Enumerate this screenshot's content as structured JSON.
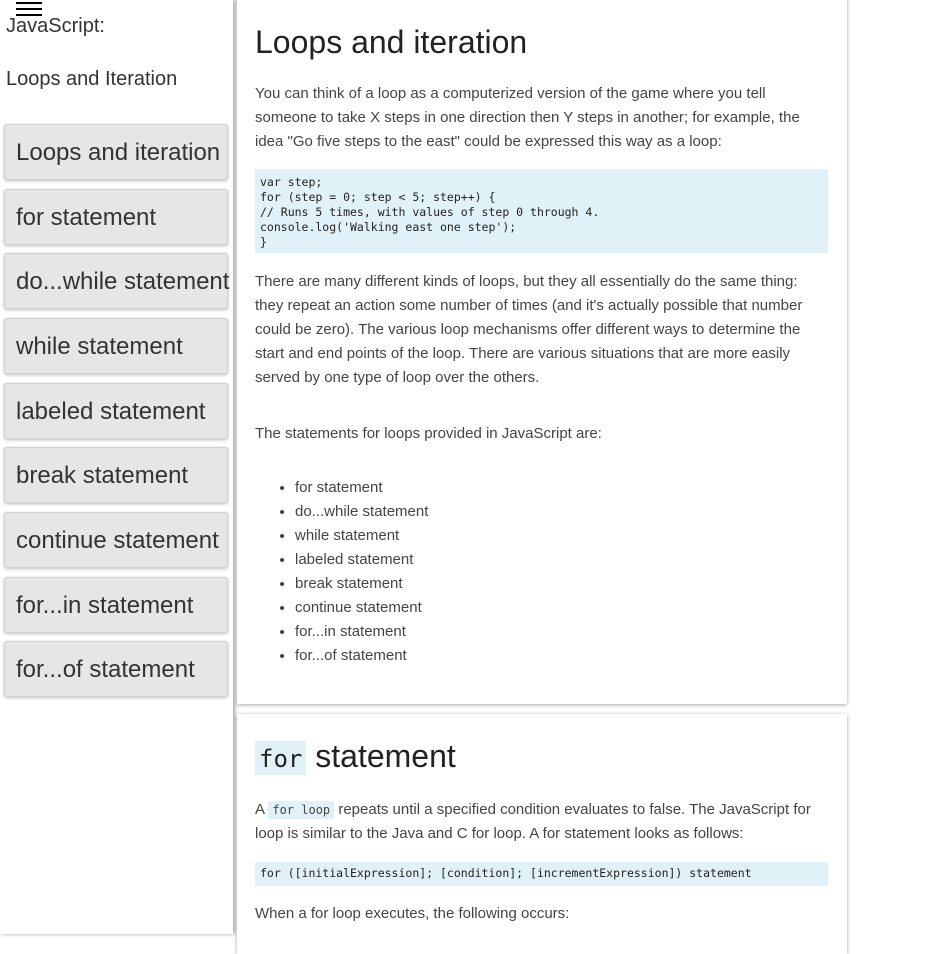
{
  "sidebar": {
    "title": "JavaScript:",
    "subtitle": "Loops and Iteration",
    "items": [
      {
        "label": "Loops and iteration"
      },
      {
        "label": "for statement"
      },
      {
        "label": "do...while statement"
      },
      {
        "label": "while statement"
      },
      {
        "label": "labeled statement"
      },
      {
        "label": "break statement"
      },
      {
        "label": "continue statement"
      },
      {
        "label": "for...in statement"
      },
      {
        "label": "for...of statement"
      }
    ]
  },
  "section1": {
    "heading": "Loops and iteration",
    "intro": "You can think of a loop as a computerized version of the game where you tell someone to take X steps in one direction then Y steps in another; for example, the idea \"Go five steps to the east\" could be expressed this way as a loop:",
    "code": "var step;\nfor (step = 0; step < 5; step++) {\n// Runs 5 times, with values of step 0 through 4.\nconsole.log('Walking east one step');\n}",
    "para2": "There are many different kinds of loops, but they all essentially do the same thing: they repeat an action some number of times (and it's actually possible that number could be zero). The various loop mechanisms offer different ways to determine the start and end points of the loop. There are various situations that are more easily served by one type of loop over the others.",
    "para3": "The statements for loops provided in JavaScript are:",
    "list": [
      "for statement",
      "do...while statement",
      "while statement",
      "labeled statement",
      "break statement",
      "continue statement",
      "for...in statement",
      "for...of statement"
    ]
  },
  "section2": {
    "heading_code": "for",
    "heading_text": "statement",
    "para_prefix": "A",
    "para_code": "for loop",
    "para_rest": "repeats until a specified condition evaluates to false. The JavaScript for loop is similar to the Java and C for loop. A for statement looks as follows:",
    "code": "for ([initialExpression]; [condition]; [incrementExpression]) statement",
    "para2": "When a for loop executes, the following occurs:"
  }
}
